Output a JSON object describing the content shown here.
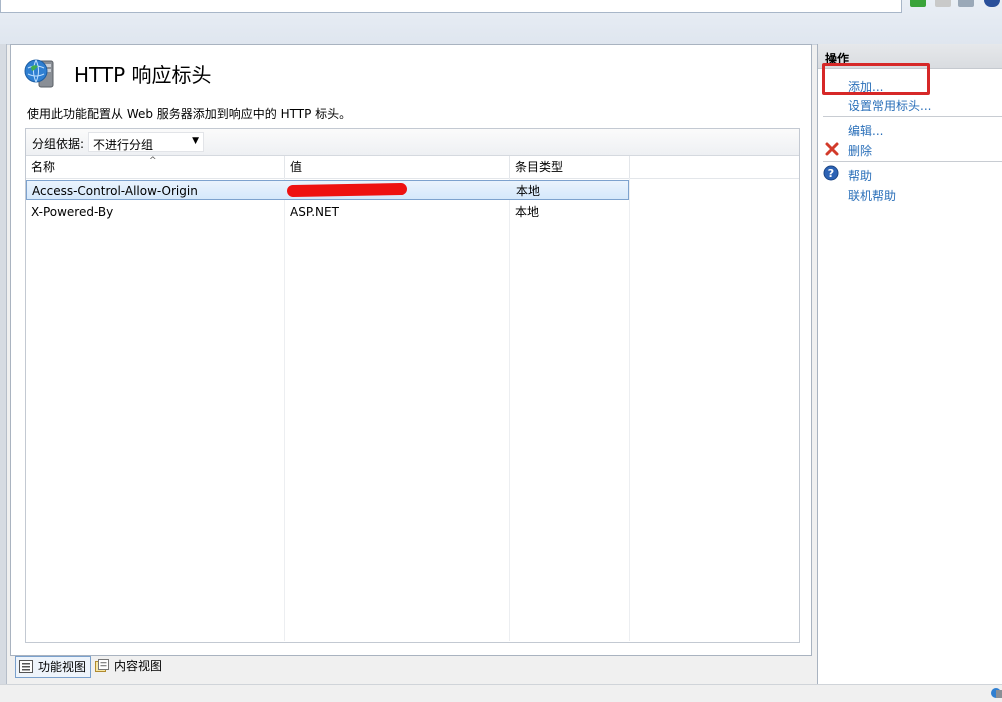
{
  "page": {
    "title": "HTTP 响应标头",
    "description": "使用此功能配置从 Web 服务器添加到响应中的 HTTP 标头。",
    "icon": "globe-server-icon"
  },
  "groupby": {
    "label": "分组依据:",
    "selected": "不进行分组"
  },
  "table": {
    "columns": [
      "名称",
      "值",
      "条目类型"
    ],
    "rows": [
      {
        "name": "Access-Control-Allow-Origin",
        "value": "",
        "type": "本地",
        "selected": true
      },
      {
        "name": "X-Powered-By",
        "value": "ASP.NET",
        "type": "本地",
        "selected": false
      }
    ]
  },
  "views": {
    "feature": "功能视图",
    "content": "内容视图"
  },
  "actions": {
    "title": "操作",
    "add": "添加...",
    "set_common": "设置常用标头...",
    "edit": "编辑...",
    "delete": "删除",
    "help": "帮助",
    "online_help": "联机帮助"
  },
  "colors": {
    "link": "#2a6fb9",
    "highlight": "#d62828",
    "selection_border": "#7da2ce"
  }
}
